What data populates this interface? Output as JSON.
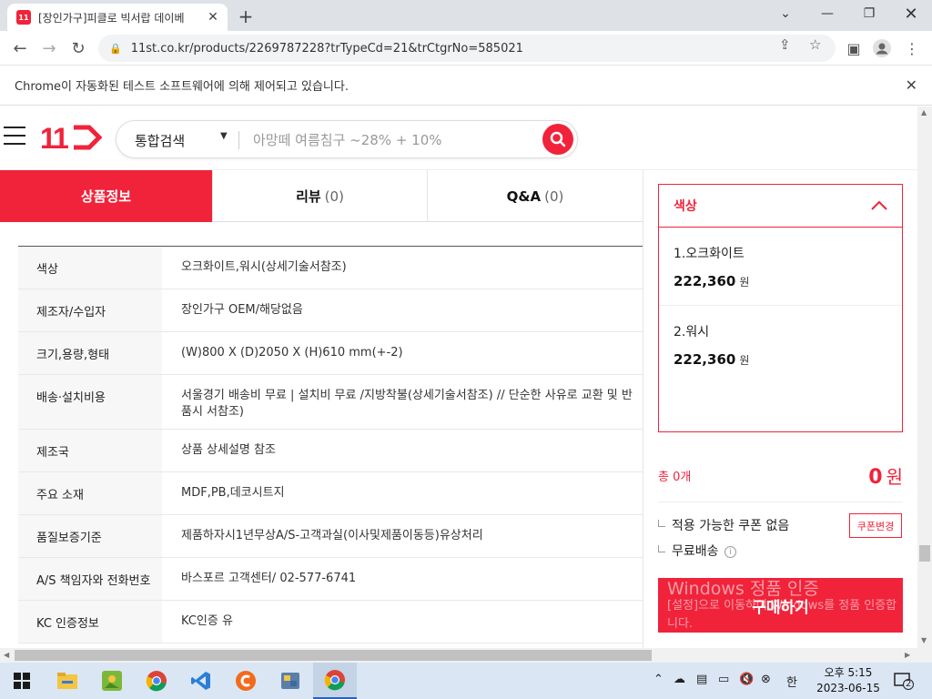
{
  "browser": {
    "tab_title": "[장인가구]피클로 빅서랍 데이베",
    "favicon_text": "11",
    "url": "11st.co.kr/products/2269787228?trTypeCd=21&trCtgrNo=585021",
    "infobar_text": "Chrome이 자동화된 테스트 소프트웨어에 의해 제어되고 있습니다."
  },
  "header": {
    "logo_text": "11",
    "search_category": "통합검색",
    "search_placeholder": "아망떼 여름침구 ~28% + 10%"
  },
  "product_tabs": [
    {
      "label": "상품정보",
      "count": ""
    },
    {
      "label": "리뷰",
      "count": "(0)"
    },
    {
      "label": "Q&A",
      "count": "(0)"
    }
  ],
  "spec_rows": [
    {
      "key": "색상",
      "value": "오크화이트,워시(상세기술서참조)"
    },
    {
      "key": "제조자/수입자",
      "value": "장인가구 OEM/해당없음"
    },
    {
      "key": "크기,용량,형태",
      "value": "(W)800 X (D)2050 X (H)610 mm(+-2)"
    },
    {
      "key": "배송·설치비용",
      "value": "서울경기 배송비 무료 | 설치비 무료 /지방착불(상세기술서참조) // 단순한 사유로 교환 및 반품시 서참조)"
    },
    {
      "key": "제조국",
      "value": "상품 상세설명 참조"
    },
    {
      "key": "주요 소재",
      "value": "MDF,PB,데코시트지"
    },
    {
      "key": "품질보증기준",
      "value": "제품하자시1년무상A/S-고객과실(이사및제품이동등)유상처리"
    },
    {
      "key": "A/S 책임자와 전화번호",
      "value": "바스포르 고객센터/ 02-577-6741"
    },
    {
      "key": "KC 인증정보",
      "value": "KC인증 유"
    }
  ],
  "side_panel": {
    "option_header": "색상",
    "options": [
      {
        "name": "1.오크화이트",
        "price": "222,360",
        "unit": "원"
      },
      {
        "name": "2.워시",
        "price": "222,360",
        "unit": "원"
      }
    ],
    "total_count": "총 0개",
    "total_price": "0",
    "total_unit": "원",
    "coupon_text": "적용 가능한 쿠폰 없음",
    "coupon_button": "쿠폰변경",
    "shipping_text": "무료배송",
    "buy_button": "구매하기"
  },
  "watermark": {
    "line1": "Windows 정품 인증",
    "line2": "[설정]으로 이동하여 Windows를 정품 인증합니다."
  },
  "taskbar": {
    "ime": "한",
    "time": "오후 5:15",
    "date": "2023-06-15",
    "notification_count": "2"
  },
  "colors": {
    "brand": "#f0233b"
  }
}
